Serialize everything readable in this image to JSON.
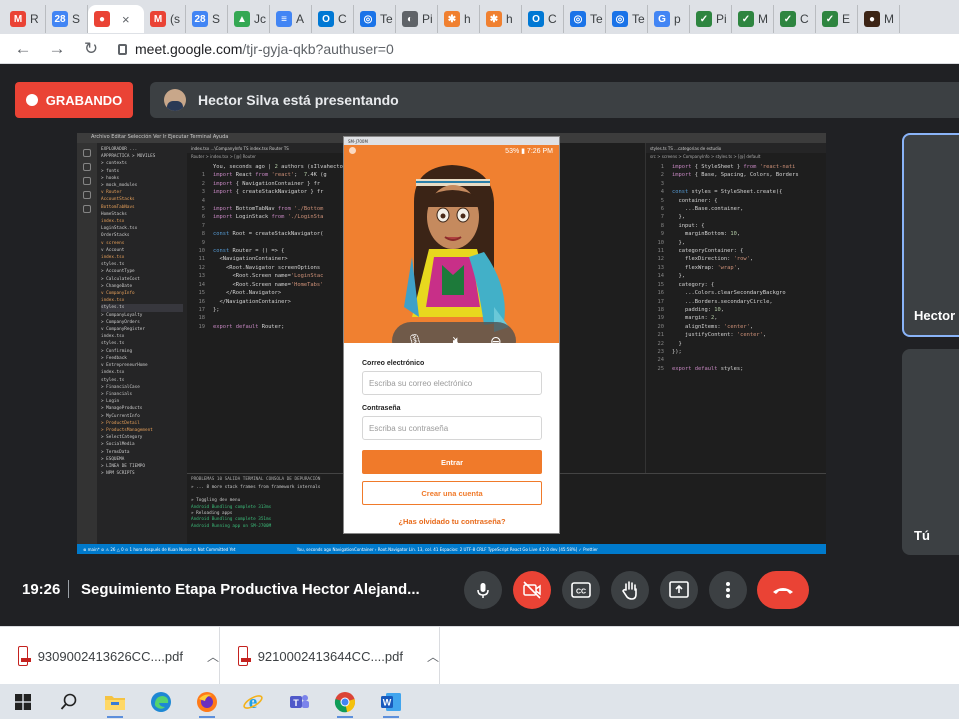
{
  "browser": {
    "tabs": [
      {
        "icon": "gmail-icon",
        "label": "R",
        "color": "#ea4335",
        "glyph": "M"
      },
      {
        "icon": "calendar-icon",
        "label": "S",
        "color": "#4285f4",
        "glyph": "28"
      },
      {
        "icon": "meet-recording-icon",
        "label": "",
        "color": "#ea4335",
        "glyph": "●",
        "active": true
      },
      {
        "icon": "gmail-icon",
        "label": "(s",
        "color": "#ea4335",
        "glyph": "M"
      },
      {
        "icon": "calendar-icon",
        "label": "S",
        "color": "#4285f4",
        "glyph": "28"
      },
      {
        "icon": "drive-icon",
        "label": "Jc",
        "color": "#34a853",
        "glyph": "▲"
      },
      {
        "icon": "docs-icon",
        "label": "A",
        "color": "#4285f4",
        "glyph": "≡"
      },
      {
        "icon": "outlook-icon",
        "label": "C",
        "color": "#0078d4",
        "glyph": "O"
      },
      {
        "icon": "target-icon",
        "label": "Te",
        "color": "#1a73e8",
        "glyph": "◎"
      },
      {
        "icon": "globe-icon",
        "label": "Pi",
        "color": "#5f6368",
        "glyph": "◐"
      },
      {
        "icon": "sena-icon",
        "label": "h",
        "color": "#f08030",
        "glyph": "✱"
      },
      {
        "icon": "sena-icon",
        "label": "h",
        "color": "#f08030",
        "glyph": "✱"
      },
      {
        "icon": "outlook-icon",
        "label": "C",
        "color": "#0078d4",
        "glyph": "O"
      },
      {
        "icon": "target-icon",
        "label": "Te",
        "color": "#1a73e8",
        "glyph": "◎"
      },
      {
        "icon": "target-icon",
        "label": "Te",
        "color": "#1a73e8",
        "glyph": "◎"
      },
      {
        "icon": "google-icon",
        "label": "p",
        "color": "#4285f4",
        "glyph": "G"
      },
      {
        "icon": "sena-leaf-icon",
        "label": "Pi",
        "color": "#2e8540",
        "glyph": "✓"
      },
      {
        "icon": "sena-leaf-icon",
        "label": "M",
        "color": "#2e8540",
        "glyph": "✓"
      },
      {
        "icon": "sena-leaf-icon",
        "label": "C",
        "color": "#2e8540",
        "glyph": "✓"
      },
      {
        "icon": "sena-leaf-icon",
        "label": "E",
        "color": "#2e8540",
        "glyph": "✓"
      },
      {
        "icon": "avatar-icon",
        "label": "M",
        "color": "#3c2415",
        "glyph": "●"
      }
    ],
    "url_host": "meet.google.com",
    "url_path": "/tjr-gyja-qkb?authuser=0"
  },
  "meet": {
    "recording_label": "GRABANDO",
    "presenting_text": "Hector Silva está presentando",
    "time": "19:26",
    "meeting_title": "Seguimiento Etapa Productiva Hector Alejand...",
    "participants": [
      {
        "name": "Hector"
      },
      {
        "name": "Tú"
      }
    ],
    "controls": [
      {
        "name": "microphone-button",
        "icon": "microphone-icon"
      },
      {
        "name": "camera-off-button",
        "icon": "camera-off-icon"
      },
      {
        "name": "captions-button",
        "icon": "captions-icon"
      },
      {
        "name": "raise-hand-button",
        "icon": "hand-icon"
      },
      {
        "name": "present-button",
        "icon": "present-icon"
      },
      {
        "name": "more-options-button",
        "icon": "more-vert-icon"
      },
      {
        "name": "hangup-button",
        "icon": "phone-hangup-icon"
      }
    ]
  },
  "shared_screen": {
    "vscode": {
      "menu": "Archivo  Editar  Selección  Ver  Ir  Ejecutar  Terminal  Ayuda",
      "left_tabs": "index.tsx ...\\CompanyInfo  TS  index.tsx Router  TS",
      "left_crumb": "Router > index.tsx > [@] Router",
      "left_code": [
        {
          "n": "",
          "text": "You, seconds ago | 2 authors (sIlvahector and ot"
        },
        {
          "n": "1",
          "text": "import React from 'react';  7.4K (g"
        },
        {
          "n": "2",
          "text": "import { NavigationContainer } fr"
        },
        {
          "n": "3",
          "text": "import { createStackNavigator } fr"
        },
        {
          "n": "4",
          "text": ""
        },
        {
          "n": "5",
          "text": "import BottomTabNav from './Bottom"
        },
        {
          "n": "6",
          "text": "import LoginStack from './LoginSta"
        },
        {
          "n": "7",
          "text": ""
        },
        {
          "n": "8",
          "text": "const Root = createStackNavigator("
        },
        {
          "n": "9",
          "text": ""
        },
        {
          "n": "10",
          "text": "const Router = () => {"
        },
        {
          "n": "11",
          "text": "  <NavigationContainer>"
        },
        {
          "n": "12",
          "text": "    <Root.Navigator screenOptions"
        },
        {
          "n": "13",
          "text": "      <Root.Screen name='LoginStac"
        },
        {
          "n": "14",
          "text": "      <Root.Screen name='HomeTabs'"
        },
        {
          "n": "15",
          "text": "    </Root.Navigator>"
        },
        {
          "n": "16",
          "text": "  </NavigationContainer>"
        },
        {
          "n": "17",
          "text": "};"
        },
        {
          "n": "18",
          "text": ""
        },
        {
          "n": "19",
          "text": "export default Router;"
        }
      ],
      "right_tabs": "styles.ts  TS   ...categorias de estudio",
      "right_crumb": "src > screens > CompanyInfo > styles.ts > [@] default",
      "right_code": [
        {
          "n": "1",
          "text": "import { StyleSheet } from 'react-nati"
        },
        {
          "n": "2",
          "text": "import { Base, Spacing, Colors, Borders"
        },
        {
          "n": "3",
          "text": ""
        },
        {
          "n": "4",
          "text": "const styles = StyleSheet.create({"
        },
        {
          "n": "5",
          "text": "  container: {"
        },
        {
          "n": "6",
          "text": "    ...Base.container,"
        },
        {
          "n": "7",
          "text": "  },"
        },
        {
          "n": "8",
          "text": "  input: {"
        },
        {
          "n": "9",
          "text": "    marginBottom: 10,"
        },
        {
          "n": "10",
          "text": "  },"
        },
        {
          "n": "11",
          "text": "  categoryContainer: {"
        },
        {
          "n": "12",
          "text": "    flexDirection: 'row',"
        },
        {
          "n": "13",
          "text": "    flexWrap: 'wrap',"
        },
        {
          "n": "14",
          "text": "  },"
        },
        {
          "n": "15",
          "text": "  category: {"
        },
        {
          "n": "16",
          "text": "    ...Colors.clearSecondaryBackgro"
        },
        {
          "n": "17",
          "text": "    ...Borders.secondaryCircle,"
        },
        {
          "n": "18",
          "text": "    padding: 10,"
        },
        {
          "n": "19",
          "text": "    margin: 2,"
        },
        {
          "n": "20",
          "text": "    alignItems: 'center',"
        },
        {
          "n": "21",
          "text": "    justifyContent: 'center',"
        },
        {
          "n": "22",
          "text": "  }"
        },
        {
          "n": "23",
          "text": "});"
        },
        {
          "n": "24",
          "text": ""
        },
        {
          "n": "25",
          "text": "export default styles;"
        }
      ],
      "explorer": [
        {
          "t": "EXPLORADOR  ...",
          "c": ""
        },
        {
          "t": "APPPRACTICA > MOVILES",
          "c": ""
        },
        {
          "t": "  > contexts",
          "c": ""
        },
        {
          "t": "  > fonts",
          "c": ""
        },
        {
          "t": "  > hooks",
          "c": ""
        },
        {
          "t": "  > mock_modules",
          "c": ""
        },
        {
          "t": "  v Router",
          "c": "orange"
        },
        {
          "t": "     AccountStacks",
          "c": "orange"
        },
        {
          "t": "     BottomTabNavs",
          "c": "orange"
        },
        {
          "t": "     HomeStacks",
          "c": ""
        },
        {
          "t": "     index.tsx",
          "c": "orange"
        },
        {
          "t": "     LoginStack.tsx",
          "c": ""
        },
        {
          "t": "     OrderStacks",
          "c": ""
        },
        {
          "t": "  v screens",
          "c": "orange"
        },
        {
          "t": "    v Account",
          "c": ""
        },
        {
          "t": "       index.tsx",
          "c": "orange"
        },
        {
          "t": "       styles.ts",
          "c": ""
        },
        {
          "t": "    > AccountType",
          "c": ""
        },
        {
          "t": "    > CalculateCost",
          "c": ""
        },
        {
          "t": "    > ChangeDate",
          "c": ""
        },
        {
          "t": "    v CompanyInfo",
          "c": "orange"
        },
        {
          "t": "       index.tsx",
          "c": "orange"
        },
        {
          "t": "       styles.ts",
          "c": "sel"
        },
        {
          "t": "    > CompanyLoyalty",
          "c": ""
        },
        {
          "t": "    > CompanyOrders",
          "c": ""
        },
        {
          "t": "    v CompanyRegister",
          "c": ""
        },
        {
          "t": "       index.tsx",
          "c": ""
        },
        {
          "t": "       styles.ts",
          "c": ""
        },
        {
          "t": "    > Confirming",
          "c": ""
        },
        {
          "t": "    > Feedback",
          "c": ""
        },
        {
          "t": "    v EntrepreneurHome",
          "c": ""
        },
        {
          "t": "       index.tsx",
          "c": ""
        },
        {
          "t": "       styles.ts",
          "c": ""
        },
        {
          "t": "    > FinancialCase",
          "c": ""
        },
        {
          "t": "    > Financials",
          "c": ""
        },
        {
          "t": "    > Login",
          "c": ""
        },
        {
          "t": "    > ManageProducts",
          "c": ""
        },
        {
          "t": "    > MyCurrentInfo",
          "c": ""
        },
        {
          "t": "    > ProductDetail",
          "c": "orange"
        },
        {
          "t": "    > ProductsManagement",
          "c": "orange"
        },
        {
          "t": "    > SelectCategory",
          "c": ""
        },
        {
          "t": "    > SocialMedia",
          "c": ""
        },
        {
          "t": "    > TermsData",
          "c": ""
        },
        {
          "t": "> ESQUEMA",
          "c": ""
        },
        {
          "t": "> LÍNEA DE TIEMPO",
          "c": ""
        },
        {
          "t": "> NPM SCRIPTS",
          "c": ""
        }
      ],
      "terminal_tabs": "PROBLEMAS  10   SALIDA   TERMINAL   CONSOLA DE DEPURACIÓN",
      "terminal_lines": [
        "» ... 8 more stack frames from framework internals",
        "",
        "» Toggling dev menu",
        "Android Bundling complete 313ms",
        "» Reloading apps",
        "Android Bundling complete 351ms",
        "Android Running app on SM-J700M"
      ],
      "status_left": "⊗ main*  ⊘  ⚠ 26 △ 0   ⊙ 1 hora después de Kuan Nunez   ⊙ Not Committed Yet",
      "status_right": "You, seconds ago   NavigationContainer › Root.Navigator   Lín. 13, col. 41   Espacios: 2   UTF-8   CRLF   TypeScript React   Go Live   4.2.0 dev [45:58%]   ✓ Prettier",
      "minimap_hint": "unsafe[line] Targets"
    },
    "emulator": {
      "window_title": "SM-J700M",
      "status_text": "53% ▮ 7:26 PM",
      "email_label": "Correo electrónico",
      "email_placeholder": "Escriba su correo electrónico",
      "password_label": "Contraseña",
      "password_placeholder": "Escriba su contraseña",
      "login_button": "Entrar",
      "signup_button": "Crear una cuenta",
      "forgot_link": "¿Has olvidado tu contraseña?"
    }
  },
  "downloads": [
    {
      "name": "9309002413626CC....pdf"
    },
    {
      "name": "9210002413644CC....pdf"
    }
  ],
  "taskbar": [
    {
      "name": "start-button",
      "icon": "windows-icon"
    },
    {
      "name": "search-button",
      "icon": "search-icon"
    },
    {
      "name": "file-explorer",
      "icon": "folder-icon",
      "running": true
    },
    {
      "name": "edge",
      "icon": "edge-icon"
    },
    {
      "name": "firefox",
      "icon": "firefox-icon",
      "running": true
    },
    {
      "name": "internet-explorer",
      "icon": "ie-icon"
    },
    {
      "name": "teams",
      "icon": "teams-icon"
    },
    {
      "name": "chrome",
      "icon": "chrome-icon",
      "running": true
    },
    {
      "name": "word",
      "icon": "word-icon",
      "running": true
    }
  ]
}
